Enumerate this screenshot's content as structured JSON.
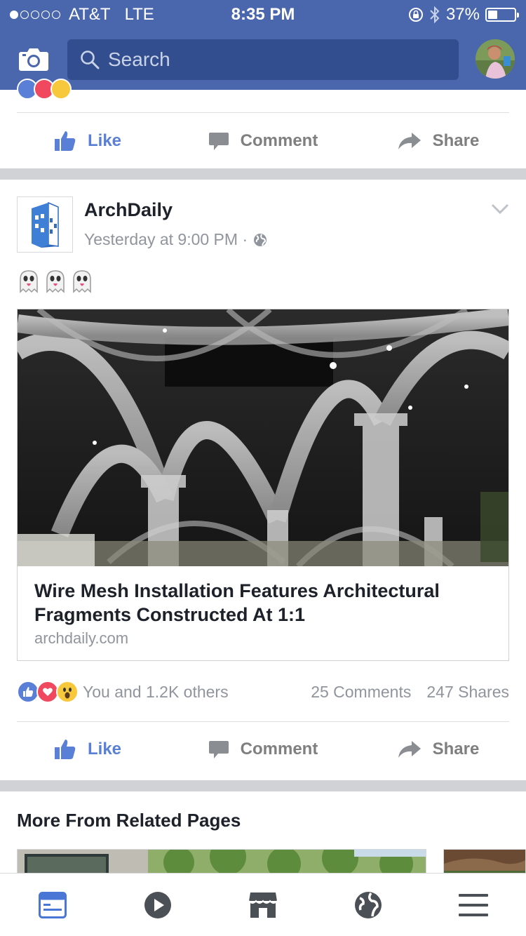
{
  "status_bar": {
    "carrier": "AT&T",
    "network": "LTE",
    "time": "8:35 PM",
    "battery_percent": "37%",
    "battery_level": 0.37,
    "signal_bars": 1
  },
  "header": {
    "search_placeholder": "Search"
  },
  "previous_post_actions": {
    "like": "Like",
    "comment": "Comment",
    "share": "Share"
  },
  "post": {
    "page_name": "ArchDaily",
    "timestamp": "Yesterday at 9:00 PM ·",
    "body_emojis": "👻👻👻",
    "link": {
      "title": "Wire Mesh Installation Features Architectural Fragments Constructed At 1:1",
      "domain": "archdaily.com"
    },
    "reactions_text": "You and 1.2K others",
    "comments_count": "25 Comments",
    "shares_count": "247 Shares",
    "actions": {
      "like": "Like",
      "comment": "Comment",
      "share": "Share"
    }
  },
  "related": {
    "title": "More From Related Pages"
  },
  "tabbar": {
    "items": [
      "news-feed",
      "videos",
      "marketplace",
      "notifications",
      "menu"
    ],
    "active": "news-feed"
  },
  "colors": {
    "brand_blue": "#4a67ad",
    "like_blue": "#5a7fd6",
    "muted_text": "#90949c",
    "divider": "#d1d2d6"
  }
}
